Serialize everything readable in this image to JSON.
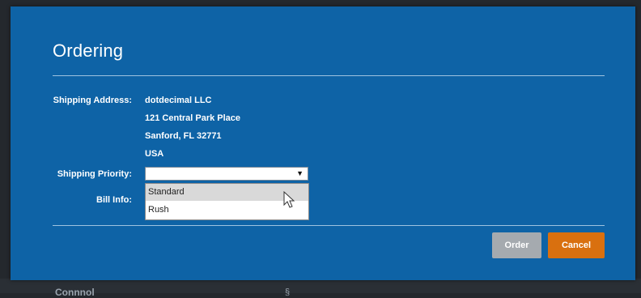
{
  "backdrop": {
    "text": "Connnol",
    "glyph": "§"
  },
  "dialog": {
    "title": "Ordering",
    "shipping_address_label": "Shipping Address:",
    "address_lines": [
      "dotdecimal LLC",
      "121 Central Park Place",
      "Sanford, FL 32771",
      "USA"
    ],
    "shipping_priority_label": "Shipping Priority:",
    "shipping_priority_value": "",
    "shipping_priority_options": [
      "Standard",
      "Rush"
    ],
    "bill_info_label": "Bill Info:",
    "order_button": "Order",
    "cancel_button": "Cancel"
  },
  "colors": {
    "dialog_bg": "#0e63a6",
    "order_button_bg": "#a5aaaf",
    "cancel_button_bg": "#d9700f"
  }
}
